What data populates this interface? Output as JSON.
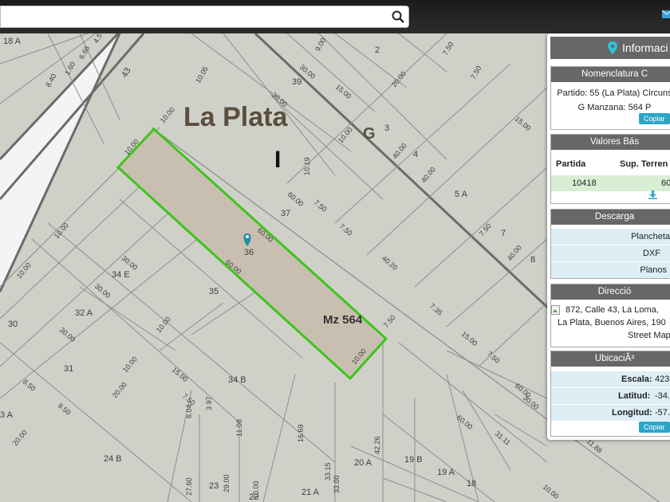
{
  "search": {
    "placeholder": "",
    "value": ""
  },
  "icons": {
    "search": "search-icon",
    "mail": "mail-icon",
    "marker": "map-marker-icon",
    "download": "download-icon",
    "info": "info-marker-icon",
    "broken_image": "broken-image-icon"
  },
  "colors": {
    "accent": "#2ba6cb",
    "parcel_border": "#33cc22",
    "section_header": "#676767",
    "map_bg": "#cfd1c8"
  },
  "map": {
    "city_label": "La Plata",
    "letters": [
      "I",
      "G"
    ],
    "block_label": "Mz 564",
    "lots": [
      "18 A",
      "43",
      "2",
      "39",
      "3",
      "4",
      "5 A",
      "7",
      "8",
      "37",
      "36",
      "34 E",
      "35",
      "32 A",
      "30",
      "31",
      "34 B",
      "3 A",
      "24 B",
      "23",
      "22",
      "20 A",
      "19 B",
      "19 A",
      "18",
      "21 A"
    ],
    "dims": [
      "8.40",
      "1.60",
      "6.66",
      "4.5",
      "10.05",
      "9.00",
      "7.50",
      "7.50",
      "15.00",
      "30.00",
      "30.00",
      "20.00",
      "15.00",
      "10.00",
      "10.00",
      "10.00",
      "10.19",
      "40.00",
      "40.00",
      "60.00",
      "7.50",
      "7.50",
      "60.00",
      "60.00",
      "10.00",
      "30.00",
      "30.00",
      "10.00",
      "30.00",
      "8.50",
      "20.00",
      "10.00",
      "10.00",
      "15.00",
      "6.04",
      "3.97",
      "20.00",
      "8.50",
      "11.08",
      "16.69",
      "42.26",
      "33.15",
      "33.00",
      "27.60",
      "29.00",
      "10.00",
      "10.00",
      "7.50",
      "7.35",
      "15.00",
      "40.20",
      "40.00",
      "7.50",
      "7.50",
      "60.00",
      "30.00",
      "11.88",
      "60.00",
      "31.11",
      "10.00",
      "7.50"
    ]
  },
  "panel": {
    "title": "Informaci",
    "nomenclatura": {
      "header": "Nomenclatura C",
      "line1": "Partido: 55 (La Plata) Circuns",
      "line2": "G Manzana: 564 P",
      "copy": "Copiar"
    },
    "valores": {
      "header": "Valores Bás",
      "col1": "Partida",
      "col2": "Sup. Terren",
      "partida": "10418",
      "sup": "60"
    },
    "descargas": {
      "header": "Descarga",
      "items": [
        "Plancheta",
        "DXF",
        "Planos"
      ]
    },
    "direccion": {
      "header": "Direcció",
      "line1": "872, Calle 43, La Loma,",
      "line2": "La Plata, Buenos Aires, 190",
      "line3": "Street Map"
    },
    "ubicacion": {
      "header": "UbicaciÃ³",
      "escala_label": "Escala:",
      "escala": "423",
      "latitud_label": "Latitud:",
      "latitud": "-34.",
      "longitud_label": "Longitud:",
      "longitud": "-57.",
      "copy": "Copiar"
    }
  }
}
